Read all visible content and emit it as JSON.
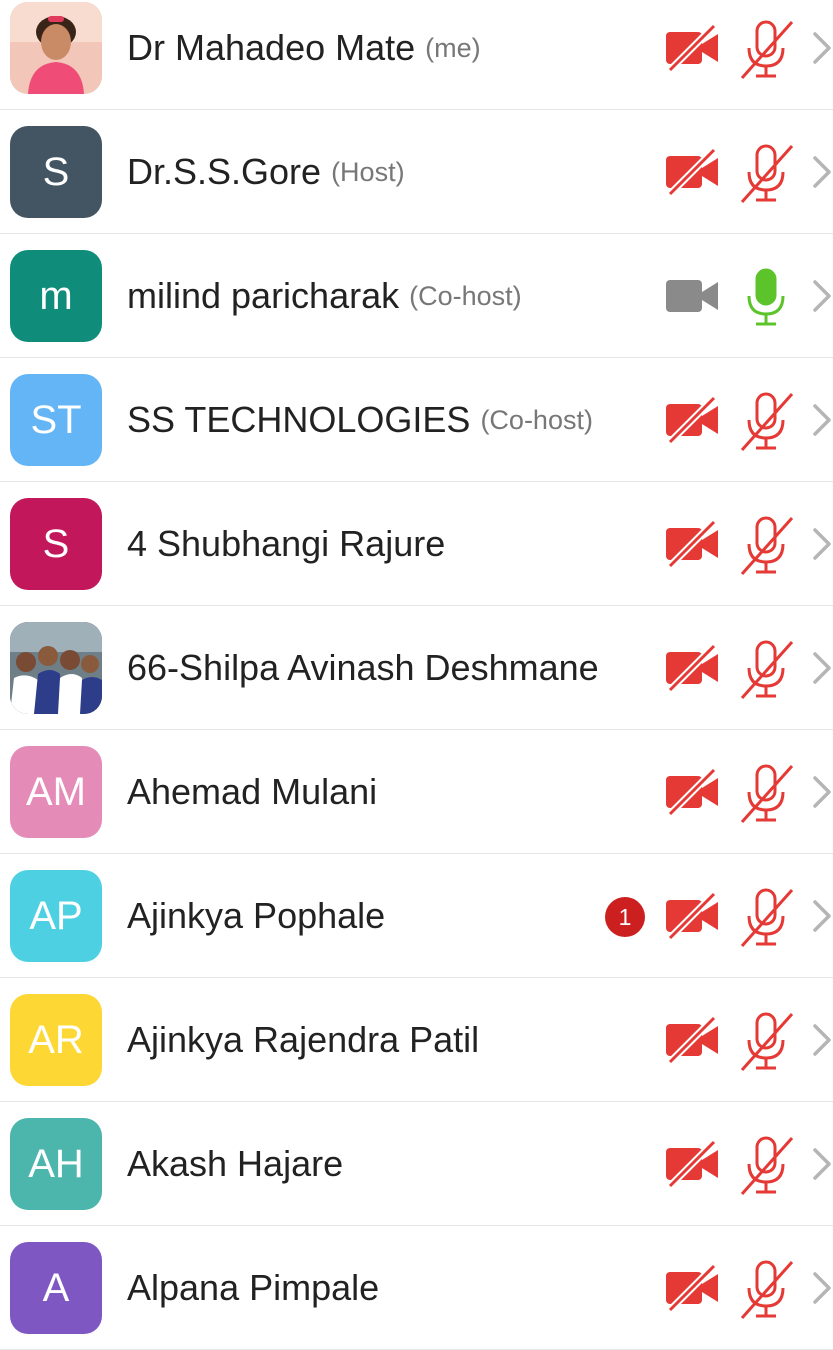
{
  "participants": [
    {
      "name": "Dr Mahadeo Mate",
      "role": "(me)",
      "avatar_text": "",
      "avatar_color": "#f3c2b4",
      "avatar_kind": "photo-child",
      "video_on": false,
      "audio_on": false,
      "unread": ""
    },
    {
      "name": "Dr.S.S.Gore",
      "role": "(Host)",
      "avatar_text": "S",
      "avatar_color": "#435563",
      "avatar_kind": "initials",
      "video_on": false,
      "audio_on": false,
      "unread": ""
    },
    {
      "name": "milind paricharak",
      "role": "(Co-host)",
      "avatar_text": "m",
      "avatar_color": "#0f8c7a",
      "avatar_kind": "initials",
      "video_on": true,
      "audio_on": true,
      "unread": ""
    },
    {
      "name": "SS TECHNOLOGIES",
      "role": "(Co-host)",
      "avatar_text": "ST",
      "avatar_color": "#64b5f6",
      "avatar_kind": "initials",
      "video_on": false,
      "audio_on": false,
      "unread": ""
    },
    {
      "name": "4 Shubhangi Rajure",
      "role": "",
      "avatar_text": "S",
      "avatar_color": "#c2185b",
      "avatar_kind": "initials",
      "video_on": false,
      "audio_on": false,
      "unread": ""
    },
    {
      "name": "66-Shilpa Avinash Deshmane",
      "role": "",
      "avatar_text": "",
      "avatar_color": "#8d7a6a",
      "avatar_kind": "photo-group",
      "video_on": false,
      "audio_on": false,
      "unread": ""
    },
    {
      "name": "Ahemad Mulani",
      "role": "",
      "avatar_text": "AM",
      "avatar_color": "#e58bb8",
      "avatar_kind": "initials",
      "video_on": false,
      "audio_on": false,
      "unread": ""
    },
    {
      "name": "Ajinkya Pophale",
      "role": "",
      "avatar_text": "AP",
      "avatar_color": "#4dd0e1",
      "avatar_kind": "initials",
      "video_on": false,
      "audio_on": false,
      "unread": "1"
    },
    {
      "name": "Ajinkya Rajendra Patil",
      "role": "",
      "avatar_text": "AR",
      "avatar_color": "#fdd835",
      "avatar_kind": "initials",
      "video_on": false,
      "audio_on": false,
      "unread": ""
    },
    {
      "name": "Akash Hajare",
      "role": "",
      "avatar_text": "AH",
      "avatar_color": "#4db6ac",
      "avatar_kind": "initials",
      "video_on": false,
      "audio_on": false,
      "unread": ""
    },
    {
      "name": "Alpana Pimpale",
      "role": "",
      "avatar_text": "A",
      "avatar_color": "#7e57c2",
      "avatar_kind": "initials",
      "video_on": false,
      "audio_on": false,
      "unread": ""
    }
  ],
  "colors": {
    "muted_red": "#e53935",
    "mic_on_green": "#5cc42a",
    "video_on_gray": "#8a8a8a",
    "chevron_gray": "#b5b5b5",
    "badge_red": "#cc1f1f"
  },
  "icons": {
    "video": "video-camera-icon",
    "video_off": "video-off-icon",
    "mic": "microphone-icon",
    "mic_off": "microphone-muted-icon",
    "chevron": "chevron-right-icon"
  }
}
